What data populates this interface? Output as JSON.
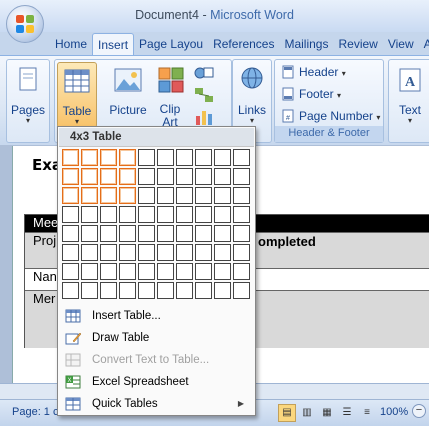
{
  "window": {
    "doc_title": "Document4",
    "separator": " - ",
    "app_title": "Microsoft Word"
  },
  "tabs": [
    "Home",
    "Insert",
    "Page Layou",
    "References",
    "Mailings",
    "Review",
    "View",
    "Add"
  ],
  "ribbon": {
    "pages_label": "Pages",
    "table_label": "Table",
    "picture_label": "Picture",
    "clipart_label": "Clip Art",
    "links_label": "Links",
    "header_label": "Header",
    "footer_label": "Footer",
    "page_number_label": "Page Number",
    "header_footer_group": "Header & Footer",
    "text_label": "Text"
  },
  "document": {
    "heading": "Exa",
    "row1": "Mee",
    "row2": "Proj",
    "row2_right": "ompleted",
    "row3": "Nan",
    "row4": "Mer"
  },
  "status": {
    "page": "Page: 1 c",
    "zoom": "100%"
  },
  "table_menu": {
    "header": "4x3 Table",
    "grid_cols": 10,
    "grid_rows": 8,
    "selected_cols": 4,
    "selected_rows": 3,
    "items": [
      {
        "label": "Insert Table...",
        "disabled": false
      },
      {
        "label": "Draw Table",
        "disabled": false
      },
      {
        "label": "Convert Text to Table...",
        "disabled": true
      },
      {
        "label": "Excel Spreadsheet",
        "disabled": false
      },
      {
        "label": "Quick Tables",
        "disabled": false
      }
    ]
  },
  "colors": {
    "accent": "#15428b",
    "selected_cell": "#e46d1a",
    "pressed_button": "#f8c36b"
  }
}
